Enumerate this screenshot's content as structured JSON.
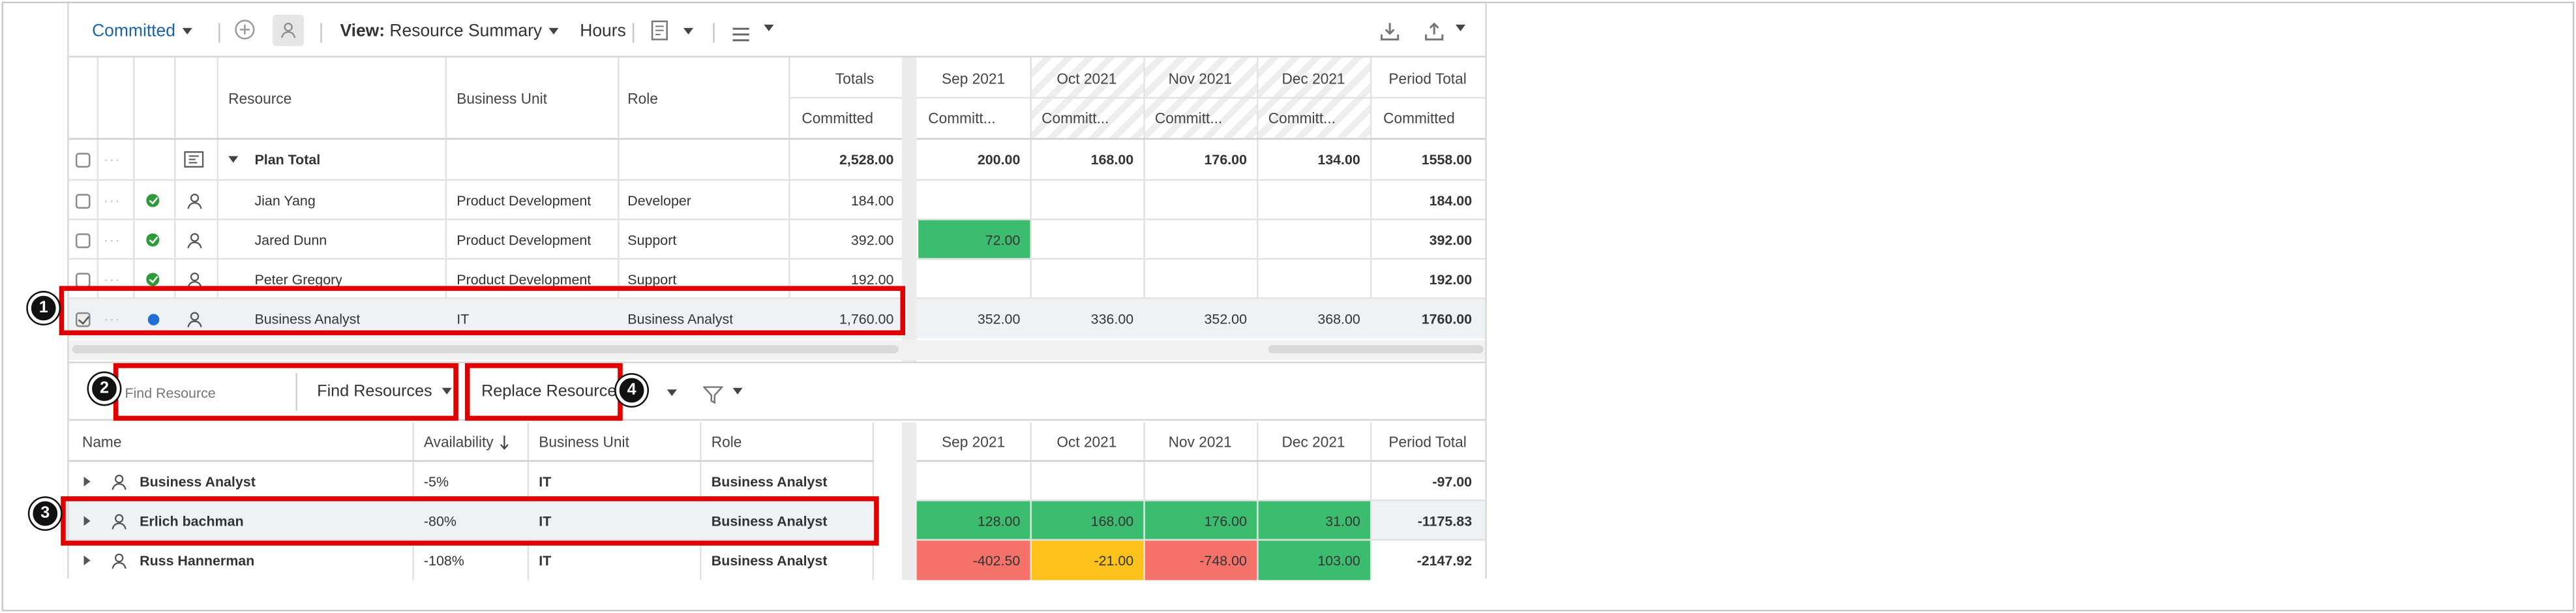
{
  "toolbar": {
    "committed_label": "Committed",
    "view_prefix": "View:",
    "view_value": "Resource Summary",
    "hours_label": "Hours"
  },
  "top_grid": {
    "headers": {
      "resource": "Resource",
      "business_unit": "Business Unit",
      "role": "Role",
      "totals": "Totals",
      "totals_sub": "Committed",
      "months": [
        "Sep 2021",
        "Oct 2021",
        "Nov 2021",
        "Dec 2021"
      ],
      "months_sub": [
        "Committ...",
        "Committ...",
        "Committ...",
        "Committ..."
      ],
      "period_total": "Period Total",
      "period_total_sub": "Committed"
    },
    "plan_total": {
      "label": "Plan Total",
      "total": "2,528.00",
      "months": [
        "200.00",
        "168.00",
        "176.00",
        "134.00"
      ],
      "period_total": "1558.00"
    },
    "rows": [
      {
        "resource": "Jian Yang",
        "business_unit": "Product Development",
        "role": "Developer",
        "total": "184.00",
        "months": [
          "",
          "",
          "",
          ""
        ],
        "period_total": "184.00"
      },
      {
        "resource": "Jared Dunn",
        "business_unit": "Product Development",
        "role": "Support",
        "total": "392.00",
        "months": [
          "72.00",
          "",
          "",
          ""
        ],
        "period_total": "392.00"
      },
      {
        "resource": "Peter Gregory",
        "business_unit": "Product Development",
        "role": "Support",
        "total": "192.00",
        "months": [
          "",
          "",
          "",
          ""
        ],
        "period_total": "192.00"
      },
      {
        "resource": "Business Analyst",
        "business_unit": "IT",
        "role": "Business Analyst",
        "total": "1,760.00",
        "months": [
          "352.00",
          "336.00",
          "352.00",
          "368.00"
        ],
        "period_total": "1760.00"
      }
    ]
  },
  "find": {
    "placeholder": "Find Resource",
    "find_resources_label": "Find Resources",
    "replace_label": "Replace Resource"
  },
  "bottom_grid": {
    "headers": {
      "name": "Name",
      "availability": "Availability",
      "business_unit": "Business Unit",
      "role": "Role",
      "months": [
        "Sep 2021",
        "Oct 2021",
        "Nov 2021",
        "Dec 2021"
      ],
      "period_total": "Period Total"
    },
    "rows": [
      {
        "name": "Business Analyst",
        "availability": "-5%",
        "business_unit": "IT",
        "role": "Business Analyst",
        "months": [
          "",
          "",
          "",
          ""
        ],
        "period_total": "-97.00"
      },
      {
        "name": "Erlich bachman",
        "availability": "-80%",
        "business_unit": "IT",
        "role": "Business Analyst",
        "months": [
          "128.00",
          "168.00",
          "176.00",
          "31.00"
        ],
        "period_total": "-1175.83"
      },
      {
        "name": "Russ Hannerman",
        "availability": "-108%",
        "business_unit": "IT",
        "role": "Business Analyst",
        "months": [
          "-402.50",
          "-21.00",
          "-748.00",
          "103.00"
        ],
        "period_total": "-2147.92"
      }
    ]
  },
  "badges": [
    "1",
    "2",
    "3",
    "4"
  ],
  "colors": {
    "accent": "#1d64a7",
    "annotation": "#e00000",
    "green": "#3cbc6e",
    "red": "#f4726a",
    "yellow": "#fdc21b"
  }
}
